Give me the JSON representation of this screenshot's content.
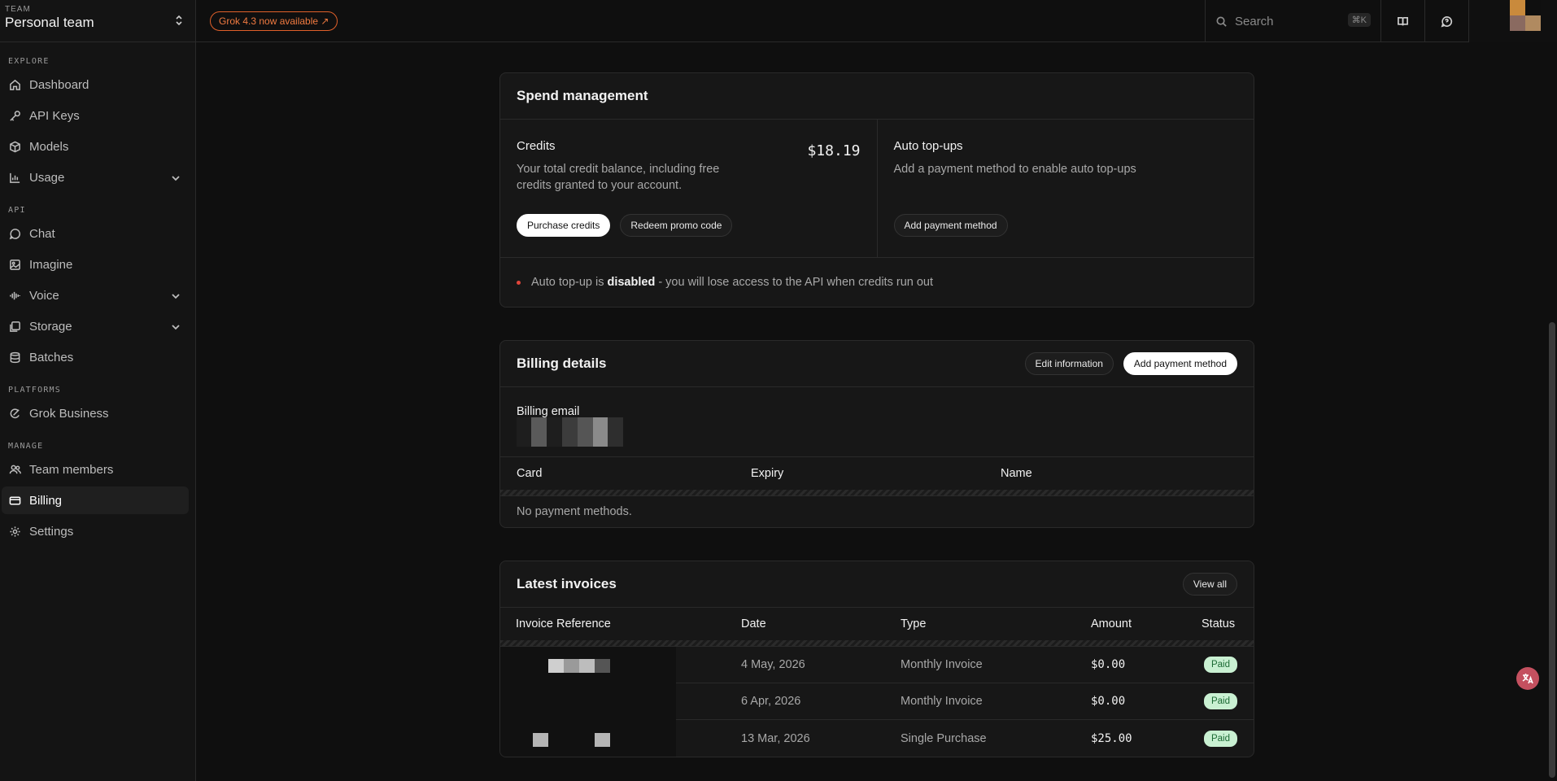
{
  "sidebar": {
    "team_label": "TEAM",
    "team_name": "Personal team",
    "sections": [
      {
        "label": "EXPLORE",
        "items": [
          {
            "label": "Dashboard",
            "icon": "home-icon"
          },
          {
            "label": "API Keys",
            "icon": "key-icon"
          },
          {
            "label": "Models",
            "icon": "cube-icon"
          },
          {
            "label": "Usage",
            "icon": "chart-icon",
            "expandable": true
          }
        ]
      },
      {
        "label": "API",
        "items": [
          {
            "label": "Chat",
            "icon": "chat-icon"
          },
          {
            "label": "Imagine",
            "icon": "image-icon"
          },
          {
            "label": "Voice",
            "icon": "waveform-icon",
            "expandable": true
          },
          {
            "label": "Storage",
            "icon": "storage-icon",
            "expandable": true
          },
          {
            "label": "Batches",
            "icon": "database-icon"
          }
        ]
      },
      {
        "label": "PLATFORMS",
        "items": [
          {
            "label": "Grok Business",
            "icon": "grok-icon"
          }
        ]
      },
      {
        "label": "MANAGE",
        "items": [
          {
            "label": "Team members",
            "icon": "users-icon"
          },
          {
            "label": "Billing",
            "icon": "card-icon",
            "active": true
          },
          {
            "label": "Settings",
            "icon": "gear-icon"
          }
        ]
      }
    ]
  },
  "topbar": {
    "announcement": "Grok 4.3 now available ↗",
    "search_placeholder": "Search",
    "search_shortcut": "⌘K"
  },
  "spend": {
    "title": "Spend management",
    "credits_title": "Credits",
    "credits_amount": "$18.19",
    "credits_desc": "Your total credit balance, including free credits granted to your account.",
    "purchase_label": "Purchase credits",
    "redeem_label": "Redeem promo code",
    "autotopup_title": "Auto top-ups",
    "autotopup_desc": "Add a payment method to enable auto top-ups",
    "add_payment_label": "Add payment method",
    "notice_prefix": "Auto top-up is",
    "notice_status": "disabled",
    "notice_suffix": "- you will lose access to the API when credits run out"
  },
  "billing": {
    "title": "Billing details",
    "edit_label": "Edit information",
    "add_payment_label": "Add payment method",
    "email_label": "Billing email",
    "columns": [
      "Card",
      "Expiry",
      "Name"
    ],
    "empty_text": "No payment methods."
  },
  "invoices": {
    "title": "Latest invoices",
    "view_all_label": "View all",
    "columns": [
      "Invoice Reference",
      "Date",
      "Type",
      "Amount",
      "Status"
    ],
    "rows": [
      {
        "date": "4 May, 2026",
        "type": "Monthly Invoice",
        "amount": "$0.00",
        "status": "Paid"
      },
      {
        "date": "6 Apr, 2026",
        "type": "Monthly Invoice",
        "amount": "$0.00",
        "status": "Paid"
      },
      {
        "date": "13 Mar, 2026",
        "type": "Single Purchase",
        "amount": "$25.00",
        "status": "Paid"
      }
    ]
  },
  "colors": {
    "accent_orange": "#e0602a",
    "paid_badge_bg": "#c9f0d2",
    "alert_dot": "#e0453a"
  }
}
